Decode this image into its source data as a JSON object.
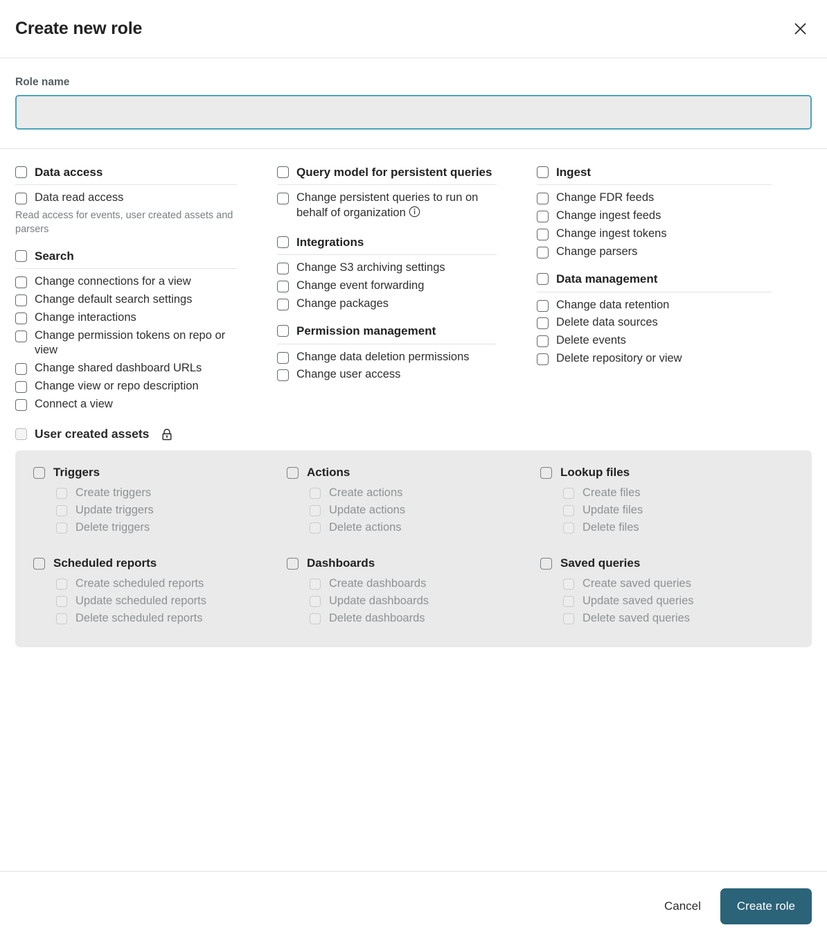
{
  "dialog": {
    "title": "Create new role",
    "close_icon": "close-icon"
  },
  "role_name": {
    "label": "Role name",
    "value": "",
    "placeholder": ""
  },
  "colors": {
    "primary_button": "#2b6378",
    "input_focus_border": "#4da3bd",
    "panel_background": "#eaeaea"
  },
  "permission_columns": [
    {
      "groups": [
        {
          "title": "Data access",
          "items": [
            {
              "label": "Data read access"
            }
          ],
          "help_text": "Read access for events, user created assets and parsers"
        },
        {
          "title": "Search",
          "items": [
            {
              "label": "Change connections for a view"
            },
            {
              "label": "Change default search settings"
            },
            {
              "label": "Change interactions"
            },
            {
              "label": "Change permission tokens on repo or view"
            },
            {
              "label": "Change shared dashboard URLs"
            },
            {
              "label": "Change view or repo description"
            },
            {
              "label": "Connect a view"
            }
          ]
        }
      ]
    },
    {
      "groups": [
        {
          "title": "Query model for persistent queries",
          "items": [
            {
              "label": "Change persistent queries to run on behalf of organization",
              "info_icon": "info-icon"
            }
          ]
        },
        {
          "title": "Integrations",
          "items": [
            {
              "label": "Change S3 archiving settings"
            },
            {
              "label": "Change event forwarding"
            },
            {
              "label": "Change packages"
            }
          ]
        },
        {
          "title": "Permission management",
          "items": [
            {
              "label": "Change data deletion permissions"
            },
            {
              "label": "Change user access"
            }
          ]
        }
      ]
    },
    {
      "groups": [
        {
          "title": "Ingest",
          "items": [
            {
              "label": "Change FDR feeds"
            },
            {
              "label": "Change ingest feeds"
            },
            {
              "label": "Change ingest tokens"
            },
            {
              "label": "Change parsers"
            }
          ]
        },
        {
          "title": "Data management",
          "items": [
            {
              "label": "Change data retention"
            },
            {
              "label": "Delete data sources"
            },
            {
              "label": "Delete events"
            },
            {
              "label": "Delete repository or view"
            }
          ]
        }
      ]
    }
  ],
  "user_created_assets": {
    "title": "User created assets",
    "lock_icon": "lock-icon",
    "groups": [
      {
        "title": "Triggers",
        "items": [
          "Create triggers",
          "Update triggers",
          "Delete triggers"
        ]
      },
      {
        "title": "Actions",
        "items": [
          "Create actions",
          "Update actions",
          "Delete actions"
        ]
      },
      {
        "title": "Lookup files",
        "items": [
          "Create files",
          "Update files",
          "Delete files"
        ]
      },
      {
        "title": "Scheduled reports",
        "items": [
          "Create scheduled reports",
          "Update scheduled reports",
          "Delete scheduled reports"
        ]
      },
      {
        "title": "Dashboards",
        "items": [
          "Create dashboards",
          "Update dashboards",
          "Delete dashboards"
        ]
      },
      {
        "title": "Saved queries",
        "items": [
          "Create saved queries",
          "Update saved queries",
          "Delete saved queries"
        ]
      }
    ]
  },
  "footer": {
    "cancel_label": "Cancel",
    "submit_label": "Create role"
  }
}
